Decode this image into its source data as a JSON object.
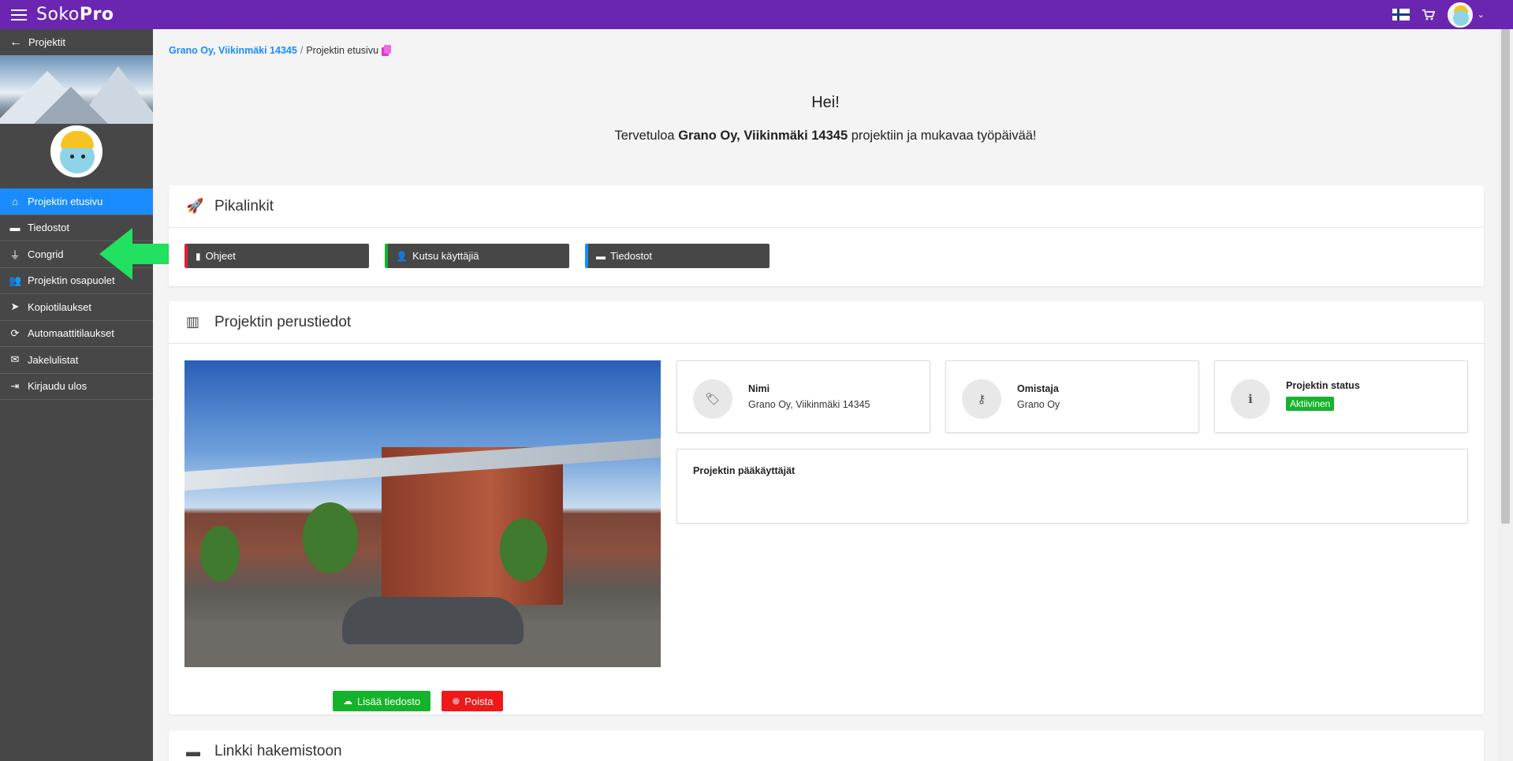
{
  "app": {
    "logo_light": "Soko",
    "logo_bold": "Pro",
    "brand_color": "#6a26b0",
    "accent_color": "#1a8cff"
  },
  "topbar": {
    "icons": [
      "menu-icon",
      "flag-fi-icon",
      "cart-icon",
      "user-avatar",
      "chevron-down-icon"
    ],
    "chevron": "⌄"
  },
  "sidebar": {
    "back_label": "Projektit",
    "items": [
      {
        "label": "Projektin etusivu",
        "icon": "home-icon",
        "glyph": "⌂",
        "active": true
      },
      {
        "label": "Tiedostot",
        "icon": "folder-icon",
        "glyph": "▬",
        "active": false
      },
      {
        "label": "Congrid",
        "icon": "plug-icon",
        "glyph": "⏚",
        "active": false
      },
      {
        "label": "Projektin osapuolet",
        "icon": "users-icon",
        "glyph": "👥",
        "active": false
      },
      {
        "label": "Kopiotilaukset",
        "icon": "paper-plane-icon",
        "glyph": "➤",
        "active": false
      },
      {
        "label": "Automaattitilaukset",
        "icon": "sync-icon",
        "glyph": "⟳",
        "active": false
      },
      {
        "label": "Jakelulistat",
        "icon": "envelope-icon",
        "glyph": "✉",
        "active": false
      },
      {
        "label": "Kirjaudu ulos",
        "icon": "sign-out-icon",
        "glyph": "⇥",
        "active": false
      }
    ]
  },
  "breadcrumb": {
    "project_link": "Grano Oy, Viikinmäki 14345",
    "separator": "/",
    "current": "Projektin etusivu"
  },
  "greeting": {
    "hello": "Hei!",
    "welcome_prefix": "Tervetuloa ",
    "welcome_project": "Grano Oy, Viikinmäki 14345",
    "welcome_suffix": " projektiin ja mukavaa työpäivää!"
  },
  "quicklinks": {
    "title": "Pikalinkit",
    "buttons": [
      {
        "label": "Ohjeet",
        "icon": "book-icon",
        "glyph": "▮",
        "color": "#e0203a"
      },
      {
        "label": "Kutsu käyttäjiä",
        "icon": "user-plus-icon",
        "glyph": "👤",
        "color": "#15b32b"
      },
      {
        "label": "Tiedostot",
        "icon": "folder-icon",
        "glyph": "▬",
        "color": "#1a8cff"
      }
    ]
  },
  "basics": {
    "title": "Projektin perustiedot",
    "add_file_label": "Lisää tiedosto",
    "delete_label": "Poista",
    "add_color": "#15b32b",
    "delete_color": "#f01818",
    "name_label": "Nimi",
    "name_value": "Grano Oy, Viikinmäki 14345",
    "owner_label": "Omistaja",
    "owner_value": "Grano Oy",
    "status_label": "Projektin status",
    "status_value": "Aktiivinen",
    "admins_label": "Projektin pääkäyttäjät"
  },
  "directory": {
    "title": "Linkki hakemistoon"
  }
}
